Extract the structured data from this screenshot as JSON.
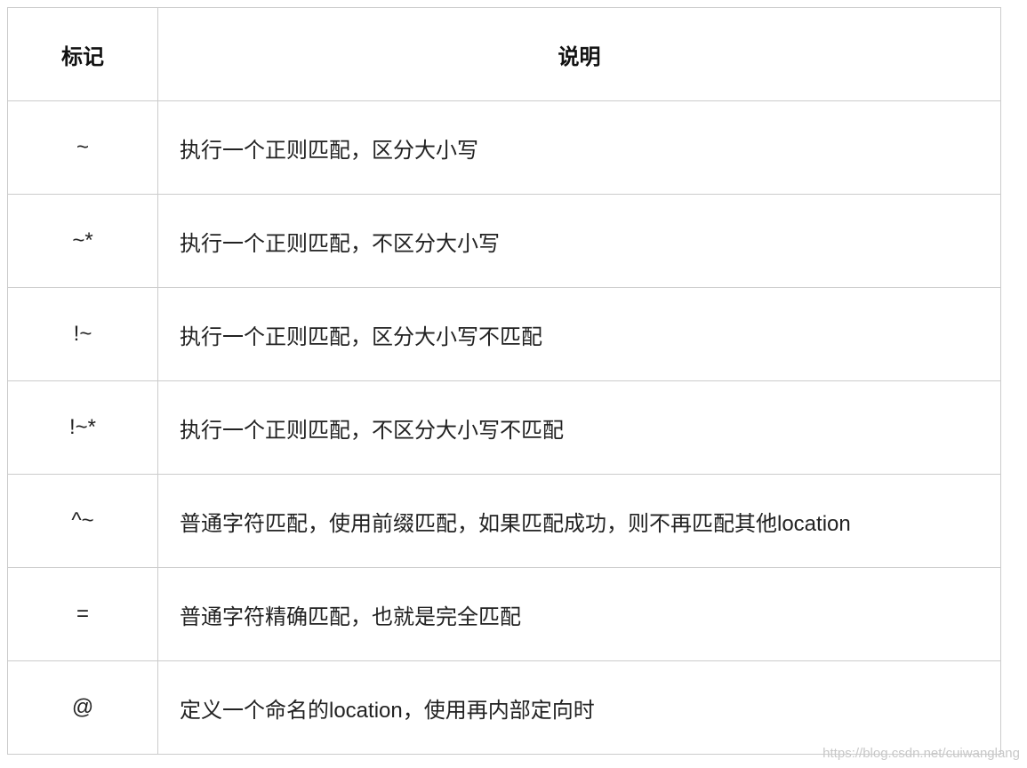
{
  "table": {
    "headers": [
      "标记",
      "说明"
    ],
    "rows": [
      {
        "mark": "~",
        "desc": "执行一个正则匹配，区分大小写"
      },
      {
        "mark": "~*",
        "desc": "执行一个正则匹配，不区分大小写"
      },
      {
        "mark": "!~",
        "desc": "执行一个正则匹配，区分大小写不匹配"
      },
      {
        "mark": "!~*",
        "desc": "执行一个正则匹配，不区分大小写不匹配"
      },
      {
        "mark": "^~",
        "desc": "普通字符匹配，使用前缀匹配，如果匹配成功，则不再匹配其他location"
      },
      {
        "mark": "=",
        "desc": "普通字符精确匹配，也就是完全匹配"
      },
      {
        "mark": "@",
        "desc": "定义一个命名的location，使用再内部定向时"
      }
    ]
  },
  "watermark": "https://blog.csdn.net/cuiwanglang"
}
